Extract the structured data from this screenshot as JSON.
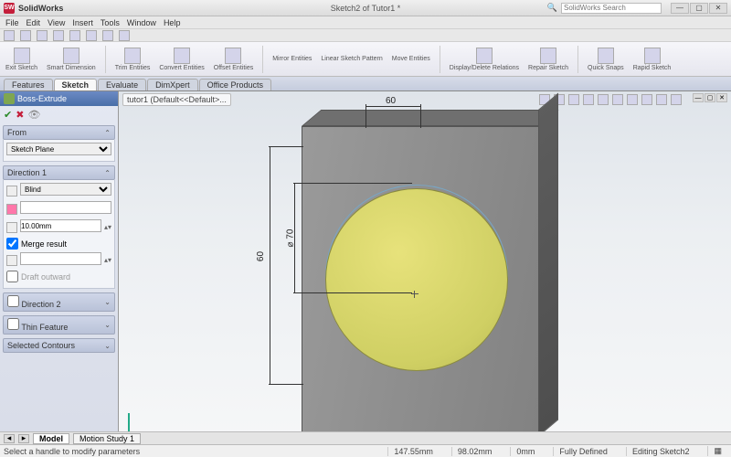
{
  "app": {
    "name": "SolidWorks",
    "document": "Sketch2 of Tutor1 *",
    "search_placeholder": "SolidWorks Search"
  },
  "menu": {
    "file": "File",
    "edit": "Edit",
    "view": "View",
    "insert": "Insert",
    "tools": "Tools",
    "window": "Window",
    "help": "Help"
  },
  "ribbon": {
    "items": [
      {
        "label": "Exit Sketch"
      },
      {
        "label": "Smart Dimension"
      },
      {
        "label": "Trim Entities"
      },
      {
        "label": "Convert Entities"
      },
      {
        "label": "Offset Entities"
      },
      {
        "label": "Mirror Entities"
      },
      {
        "label": "Linear Sketch Pattern"
      },
      {
        "label": "Move Entities"
      },
      {
        "label": "Display/Delete Relations"
      },
      {
        "label": "Repair Sketch"
      },
      {
        "label": "Quick Snaps"
      },
      {
        "label": "Rapid Sketch"
      }
    ]
  },
  "cmdtabs": {
    "features": "Features",
    "sketch": "Sketch",
    "evaluate": "Evaluate",
    "dimxpert": "DimXpert",
    "office": "Office Products"
  },
  "pm": {
    "title": "Boss-Extrude",
    "groups": {
      "from": {
        "title": "From",
        "option": "Sketch Plane"
      },
      "dir1": {
        "title": "Direction 1",
        "type": "Blind",
        "depth": "10.00mm",
        "merge": "Merge result",
        "draft": "Draft outward"
      },
      "dir2": {
        "title": "Direction 2"
      },
      "thin": {
        "title": "Thin Feature"
      },
      "sel": {
        "title": "Selected Contours"
      }
    }
  },
  "vp": {
    "breadcrumb": "tutor1 (Default<<Default>..."
  },
  "dims": {
    "width_top": "60",
    "height_left": "60",
    "diameter": "⌀ 70"
  },
  "btabs": {
    "model": "Model",
    "motion": "Motion Study 1"
  },
  "status": {
    "msg": "Select a handle to modify parameters",
    "x": "147.55mm",
    "y": "98.02mm",
    "z": "0mm",
    "def": "Fully Defined",
    "mode": "Editing Sketch2"
  }
}
